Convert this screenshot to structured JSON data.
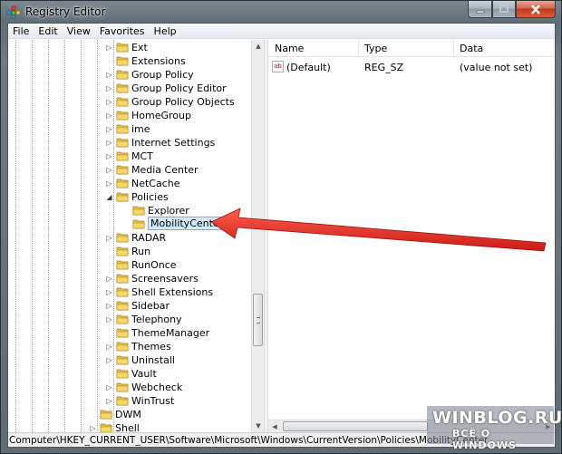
{
  "window": {
    "title": "Registry Editor",
    "icon": "registry-editor-icon",
    "minimize_icon": "minimize-icon",
    "maximize_icon": "maximize-icon",
    "close_icon": "close-icon"
  },
  "menu": [
    "File",
    "Edit",
    "View",
    "Favorites",
    "Help"
  ],
  "tree": {
    "nodes": [
      {
        "label": "Ext",
        "level": 3,
        "expander": "collapsed"
      },
      {
        "label": "Extensions",
        "level": 3,
        "expander": "none"
      },
      {
        "label": "Group Policy",
        "level": 3,
        "expander": "collapsed"
      },
      {
        "label": "Group Policy Editor",
        "level": 3,
        "expander": "collapsed"
      },
      {
        "label": "Group Policy Objects",
        "level": 3,
        "expander": "collapsed"
      },
      {
        "label": "HomeGroup",
        "level": 3,
        "expander": "collapsed"
      },
      {
        "label": "ime",
        "level": 3,
        "expander": "collapsed"
      },
      {
        "label": "Internet Settings",
        "level": 3,
        "expander": "collapsed"
      },
      {
        "label": "MCT",
        "level": 3,
        "expander": "collapsed"
      },
      {
        "label": "Media Center",
        "level": 3,
        "expander": "collapsed"
      },
      {
        "label": "NetCache",
        "level": 3,
        "expander": "collapsed"
      },
      {
        "label": "Policies",
        "level": 3,
        "expander": "expanded"
      },
      {
        "label": "Explorer",
        "level": 4,
        "expander": "none"
      },
      {
        "label": "MobilityCenter",
        "level": 4,
        "expander": "none",
        "selected": true
      },
      {
        "label": "RADAR",
        "level": 3,
        "expander": "collapsed"
      },
      {
        "label": "Run",
        "level": 3,
        "expander": "none"
      },
      {
        "label": "RunOnce",
        "level": 3,
        "expander": "none"
      },
      {
        "label": "Screensavers",
        "level": 3,
        "expander": "collapsed"
      },
      {
        "label": "Shell Extensions",
        "level": 3,
        "expander": "collapsed"
      },
      {
        "label": "Sidebar",
        "level": 3,
        "expander": "collapsed"
      },
      {
        "label": "Telephony",
        "level": 3,
        "expander": "collapsed"
      },
      {
        "label": "ThemeManager",
        "level": 3,
        "expander": "none"
      },
      {
        "label": "Themes",
        "level": 3,
        "expander": "collapsed"
      },
      {
        "label": "Uninstall",
        "level": 3,
        "expander": "collapsed"
      },
      {
        "label": "Vault",
        "level": 3,
        "expander": "none"
      },
      {
        "label": "Webcheck",
        "level": 3,
        "expander": "collapsed"
      },
      {
        "label": "WinTrust",
        "level": 3,
        "expander": "collapsed"
      },
      {
        "label": "DWM",
        "level": 2,
        "expander": "none"
      },
      {
        "label": "Shell",
        "level": 2,
        "expander": "collapsed"
      }
    ]
  },
  "list": {
    "columns": [
      "Name",
      "Type",
      "Data"
    ],
    "rows": [
      {
        "name": "(Default)",
        "type": "REG_SZ",
        "data": "(value not set)",
        "icon": "string-value-icon",
        "icon_text": "ab"
      }
    ]
  },
  "status": {
    "path": "Computer\\HKEY_CURRENT_USER\\Software\\Microsoft\\Windows\\CurrentVersion\\Policies\\MobilityCenter"
  },
  "annotation": {
    "arrow_color": "#e8241c",
    "arrow_icon": "red-arrow-pointer"
  },
  "watermark": {
    "main": "WINBLOG.RU",
    "sub": "ВСЁ О WINDOWS"
  },
  "colors": {
    "folder": "#e9c24a",
    "selection_bg": "#d6e8fb",
    "selection_border": "#84acdd"
  }
}
